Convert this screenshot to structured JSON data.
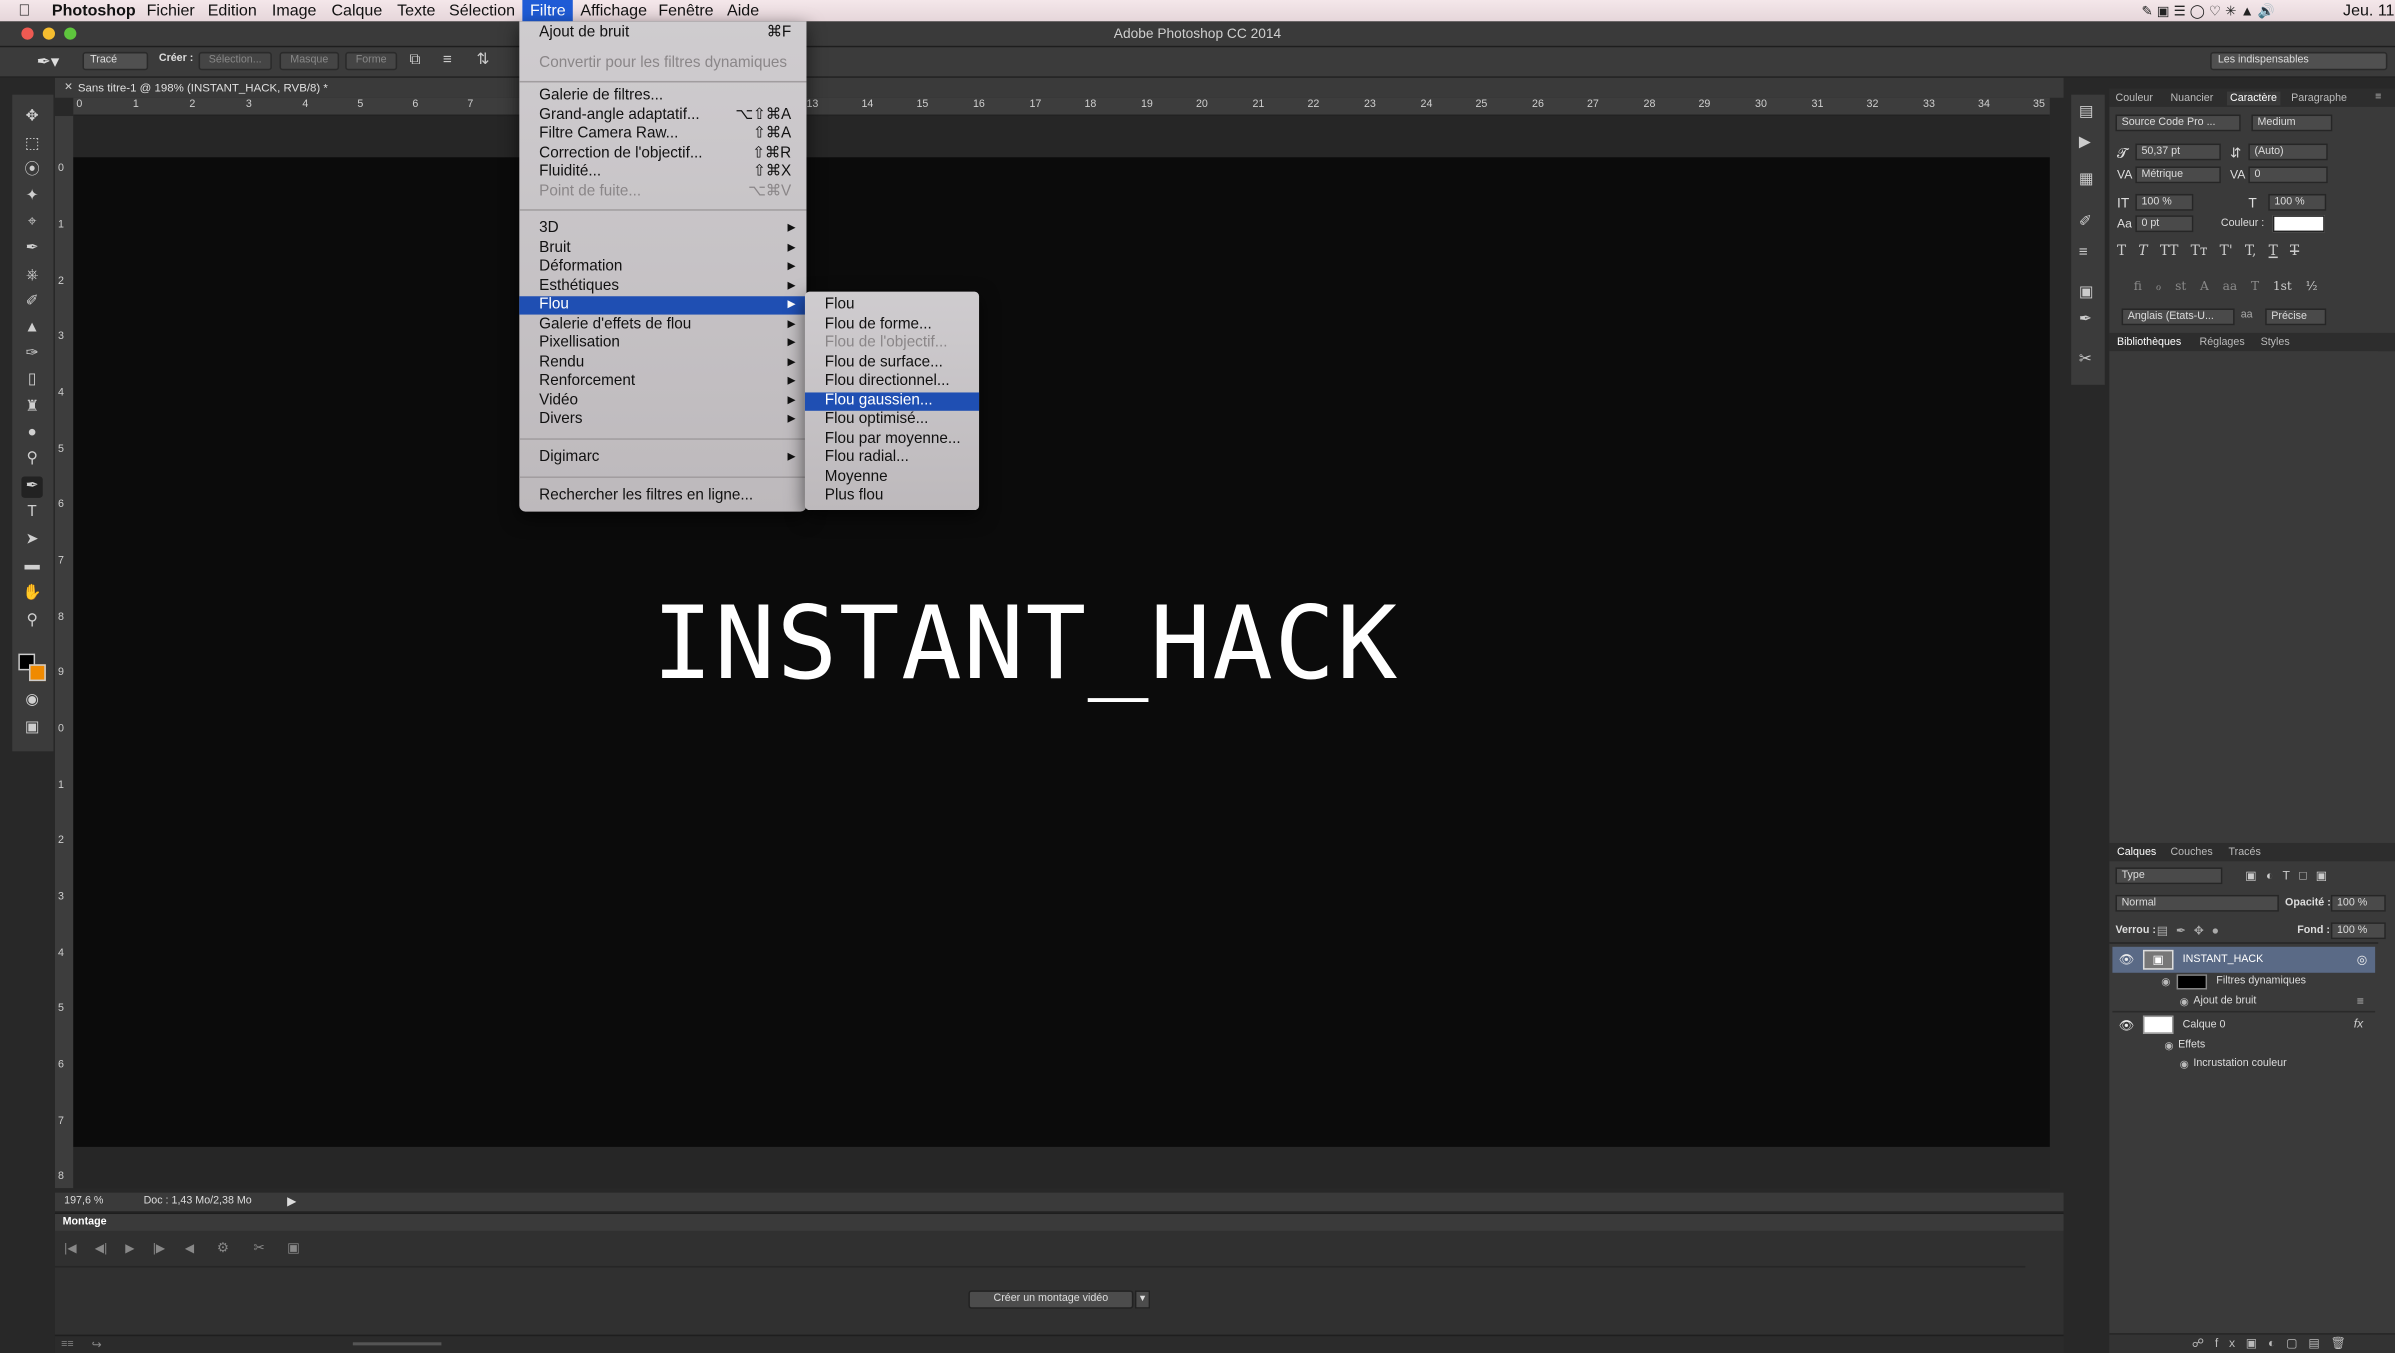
{
  "menubar": {
    "app": "Photoshop",
    "items": [
      "Fichier",
      "Edition",
      "Image",
      "Calque",
      "Texte",
      "Sélection",
      "Filtre",
      "Affichage",
      "Fenêtre",
      "Aide"
    ],
    "active": "Filtre",
    "clock": "Jeu. 11"
  },
  "window": {
    "title": "Adobe Photoshop CC 2014"
  },
  "options": {
    "mode": "Tracé",
    "create_label": "Créer :",
    "btn_selection": "Sélection...",
    "btn_masque": "Masque",
    "btn_forme": "Forme",
    "workspace": "Les indispensables"
  },
  "document": {
    "tab": "Sans titre-1 @ 198% (INSTANT_HACK, RVB/8) *",
    "text": "INSTANT_HACK",
    "zoom": "197,6 %",
    "doc_info": "Doc : 1,43 Mo/2,38 Mo",
    "ruler_h": [
      "0",
      "1",
      "2",
      "3",
      "4",
      "5",
      "6",
      "7",
      "13",
      "14",
      "15",
      "16",
      "17",
      "18",
      "19",
      "20",
      "21",
      "22",
      "23",
      "24",
      "25",
      "26",
      "27",
      "28",
      "29",
      "30",
      "31",
      "32",
      "33",
      "34",
      "35"
    ],
    "ruler_v": [
      "0",
      "1",
      "2",
      "3",
      "4",
      "5",
      "6",
      "7",
      "8",
      "9",
      "0",
      "1",
      "2",
      "3",
      "4",
      "5",
      "6",
      "7",
      "8"
    ]
  },
  "timeline": {
    "title": "Montage",
    "create_button": "Créer un montage vidéo"
  },
  "filter_menu": {
    "items": [
      {
        "label": "Ajout de bruit",
        "shortcut": "⌘F"
      },
      {
        "label": "Convertir pour les filtres dynamiques",
        "disabled": true
      },
      {
        "label": "Galerie de filtres..."
      },
      {
        "label": "Grand-angle adaptatif...",
        "shortcut": "⌥⇧⌘A"
      },
      {
        "label": "Filtre Camera Raw...",
        "shortcut": "⇧⌘A"
      },
      {
        "label": "Correction de l'objectif...",
        "shortcut": "⇧⌘R"
      },
      {
        "label": "Fluidité...",
        "shortcut": "⇧⌘X"
      },
      {
        "label": "Point de fuite...",
        "shortcut": "⌥⌘V",
        "disabled": true
      },
      {
        "label": "3D",
        "submenu": true
      },
      {
        "label": "Bruit",
        "submenu": true
      },
      {
        "label": "Déformation",
        "submenu": true
      },
      {
        "label": "Esthétiques",
        "submenu": true
      },
      {
        "label": "Flou",
        "submenu": true,
        "highlighted": true
      },
      {
        "label": "Galerie d'effets de flou",
        "submenu": true
      },
      {
        "label": "Pixellisation",
        "submenu": true
      },
      {
        "label": "Rendu",
        "submenu": true
      },
      {
        "label": "Renforcement",
        "submenu": true
      },
      {
        "label": "Vidéo",
        "submenu": true
      },
      {
        "label": "Divers",
        "submenu": true
      },
      {
        "label": "Digimarc",
        "submenu": true
      },
      {
        "label": "Rechercher les filtres en ligne..."
      }
    ]
  },
  "blur_submenu": {
    "items": [
      {
        "label": "Flou"
      },
      {
        "label": "Flou de forme..."
      },
      {
        "label": "Flou de l'objectif...",
        "disabled": true
      },
      {
        "label": "Flou de surface..."
      },
      {
        "label": "Flou directionnel..."
      },
      {
        "label": "Flou gaussien...",
        "highlighted": true
      },
      {
        "label": "Flou optimisé..."
      },
      {
        "label": "Flou par moyenne..."
      },
      {
        "label": "Flou radial..."
      },
      {
        "label": "Moyenne"
      },
      {
        "label": "Plus flou"
      }
    ]
  },
  "character_panel": {
    "tabs": [
      "Couleur",
      "Nuancier",
      "Caractère",
      "Paragraphe"
    ],
    "active_tab": "Caractère",
    "font": "Source Code Pro ...",
    "style": "Medium",
    "size": "50,37 pt",
    "leading": "(Auto)",
    "kerning": "Métrique",
    "tracking": "0",
    "vscale": "100 %",
    "hscale": "100 %",
    "baseline": "0 pt",
    "color_label": "Couleur :",
    "language": "Anglais (Etats-U...",
    "antialias": "Précise",
    "style_buttons": [
      "T",
      "T",
      "TT",
      "Tт",
      "T'",
      "T,",
      "T",
      "T"
    ],
    "opentype_buttons": [
      "fi",
      "ℴ",
      "st",
      "A",
      "aa",
      "T",
      "1st",
      "½"
    ]
  },
  "libraries_panel": {
    "tabs": [
      "Bibliothèques",
      "Réglages",
      "Styles"
    ],
    "active_tab": "Bibliothèques"
  },
  "layers_panel": {
    "tabs": [
      "Calques",
      "Couches",
      "Tracés"
    ],
    "active_tab": "Calques",
    "filter_kind": "Type",
    "blend_mode": "Normal",
    "opacity_label": "Opacité :",
    "opacity": "100 %",
    "lock_label": "Verrou :",
    "fill_label": "Fond :",
    "fill": "100 %",
    "layers": [
      {
        "name": "INSTANT_HACK",
        "selected": true
      },
      {
        "name": "Filtres dynamiques",
        "sub": 1
      },
      {
        "name": "Ajout de bruit",
        "sub": 2
      },
      {
        "name": "Calque 0"
      },
      {
        "name": "Effets",
        "sub": 1
      },
      {
        "name": "Incrustation couleur",
        "sub": 2
      }
    ]
  },
  "colors": {
    "menu_highlight": "#1f4fb3",
    "canvas": "#0b0b0b",
    "text": "#ffffff",
    "selected_layer": "#5a6a86"
  }
}
